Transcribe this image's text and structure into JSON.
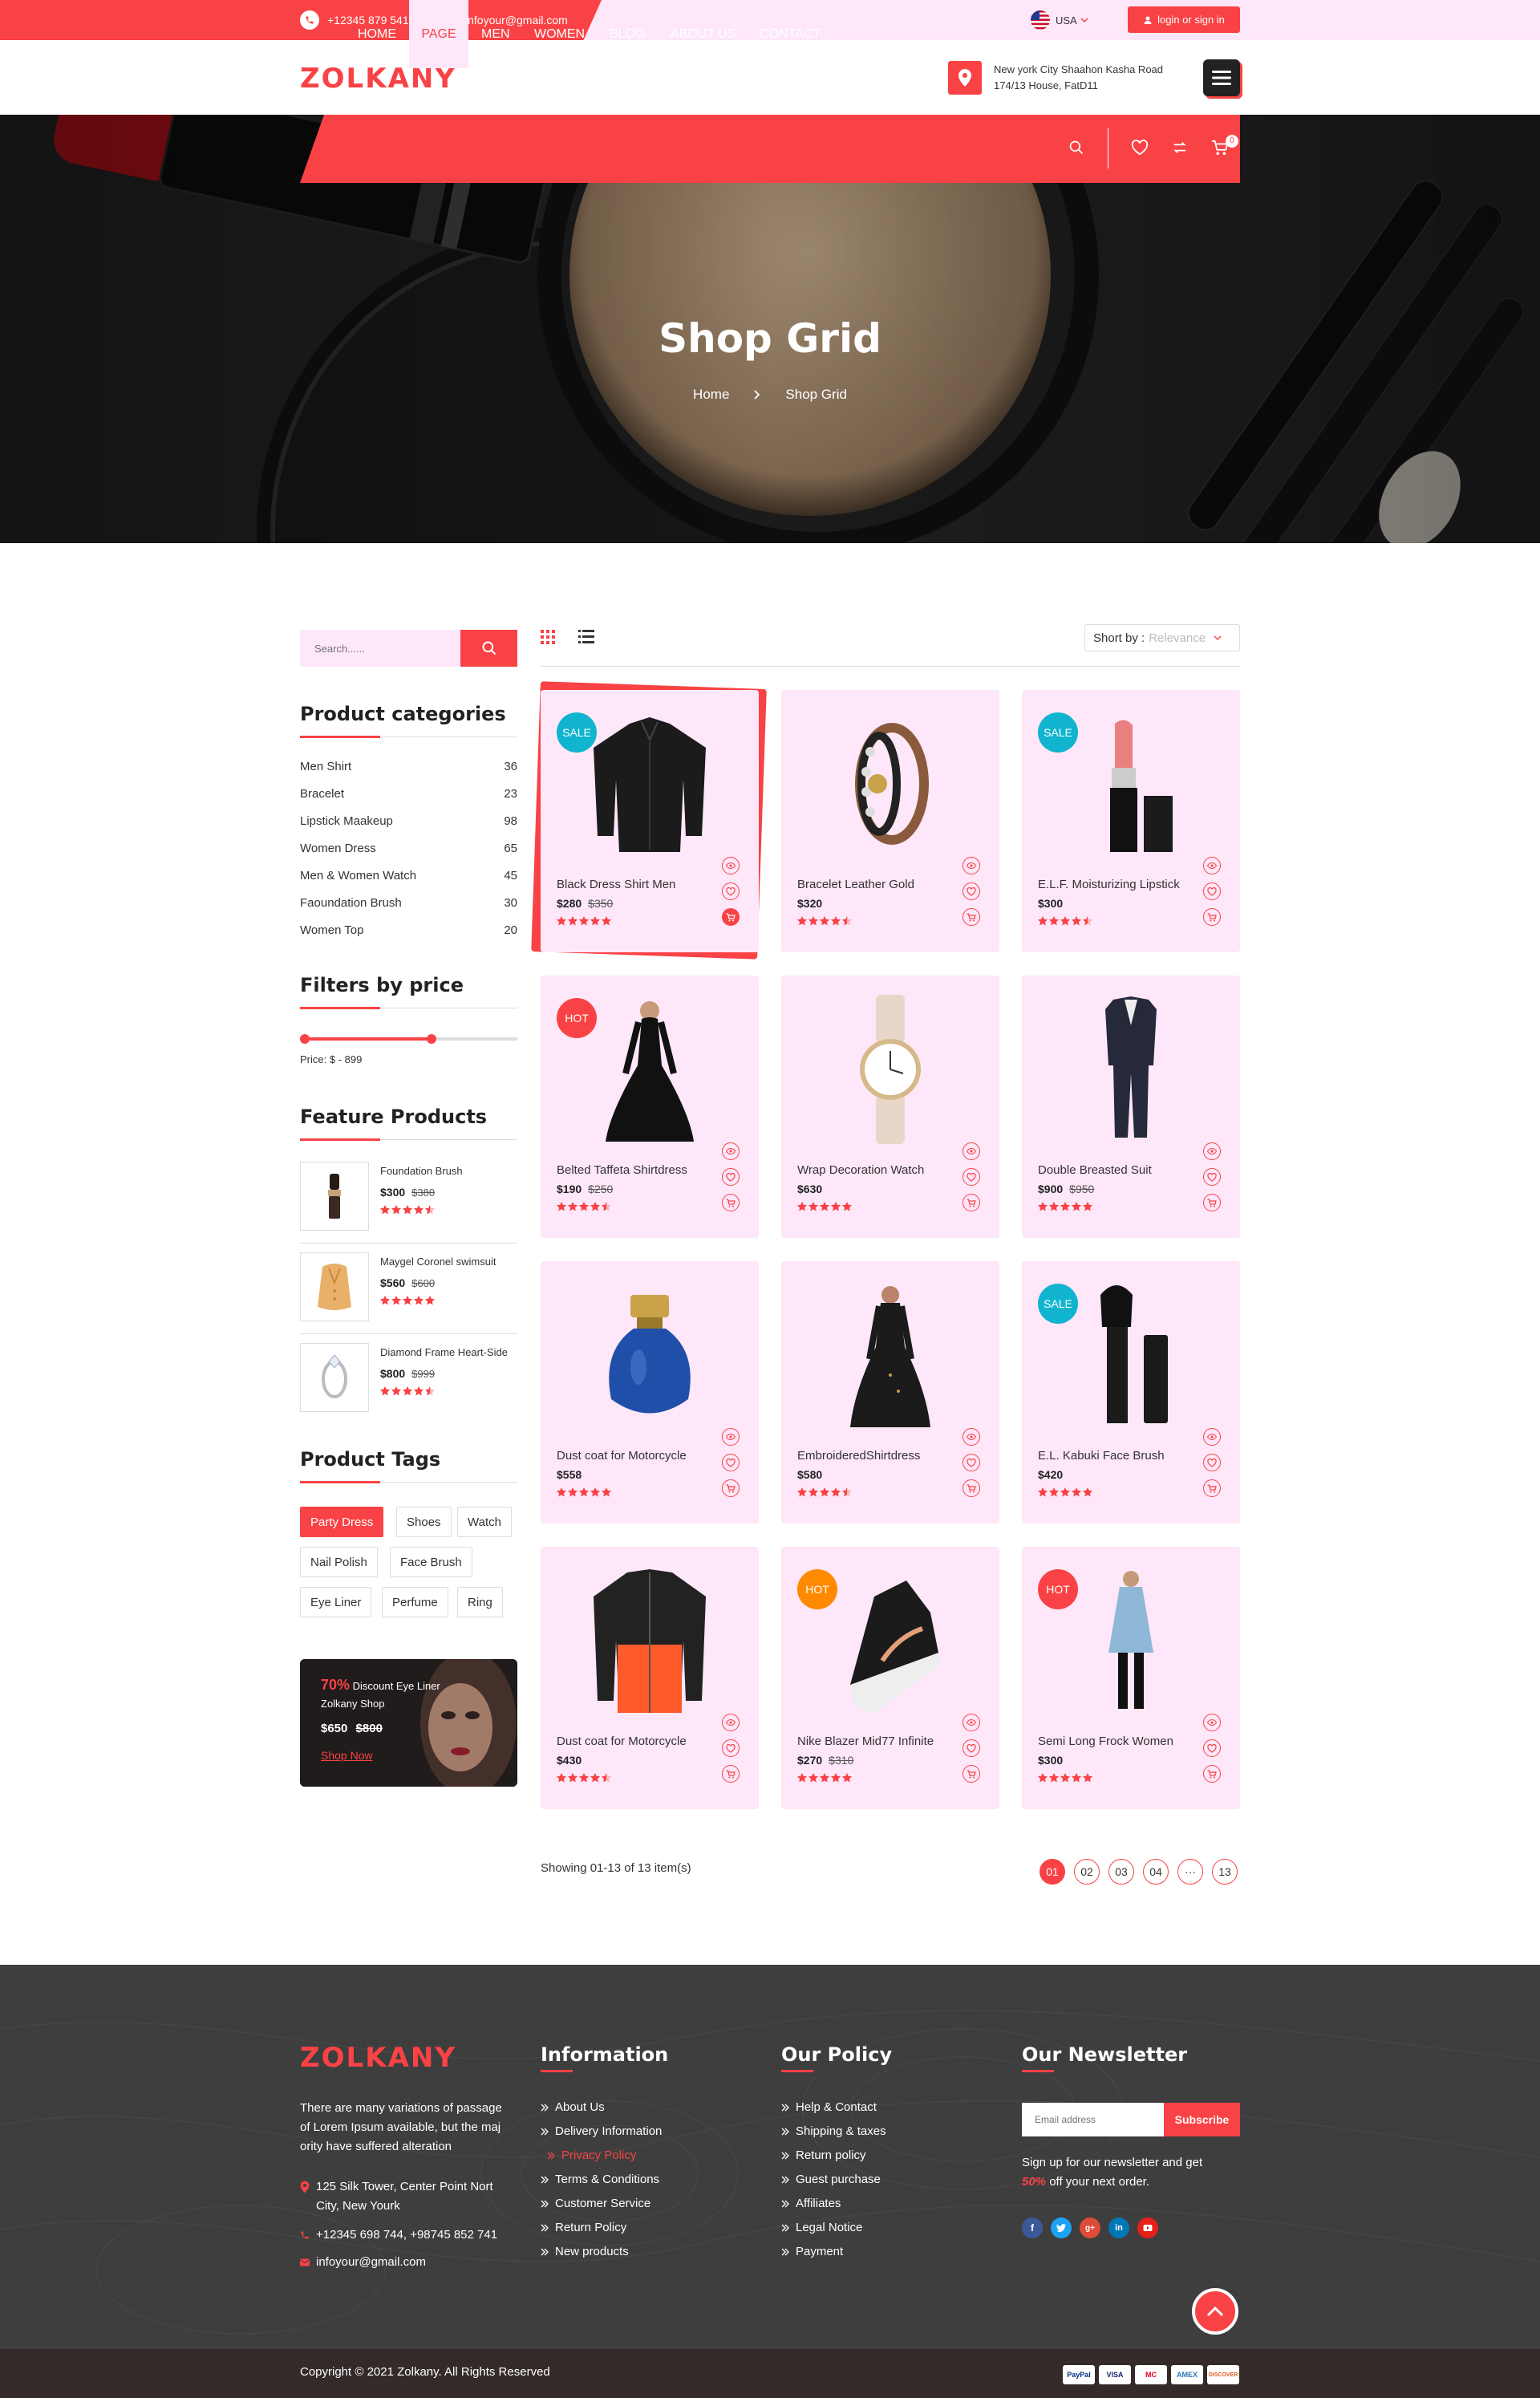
{
  "topbar": {
    "phone": "+12345 879 541",
    "email": "infoyour@gmail.com",
    "language": "USA",
    "login_label": "login or sign in"
  },
  "header": {
    "logo": "ZOLKANY",
    "address_line1": "New york City Shaahon Kasha Road",
    "address_line2": "174/13 House, FatD11"
  },
  "nav": {
    "items": [
      "HOME",
      "PAGE",
      "MEN",
      "WOMEN",
      "BLOG",
      "ABOUT US",
      "CONTACT"
    ],
    "active": "PAGE",
    "cart_count": "0"
  },
  "hero": {
    "title": "Shop Grid",
    "breadcrumb_home": "Home",
    "breadcrumb_current": "Shop Grid"
  },
  "sidebar": {
    "search_placeholder": "Search......",
    "categories_title": "Product categories",
    "categories": [
      {
        "name": "Men Shirt",
        "count": "36"
      },
      {
        "name": "Bracelet",
        "count": "23"
      },
      {
        "name": "Lipstick Maakeup",
        "count": "98"
      },
      {
        "name": "Women Dress",
        "count": "65"
      },
      {
        "name": "Men & Women Watch",
        "count": "45"
      },
      {
        "name": "Faoundation Brush",
        "count": "30"
      },
      {
        "name": "Women Top",
        "count": "20"
      }
    ],
    "price_title": "Filters by price",
    "price_label": "Price: $ - 899",
    "price_range_fraction": [
      0,
      0.6
    ],
    "featured_title": "Feature Products",
    "featured": [
      {
        "name": "Foundation Brush",
        "price": "$300",
        "old": "$380",
        "rating": 4.5
      },
      {
        "name": "Maygel Coronel swimsuit",
        "price": "$560",
        "old": "$600",
        "rating": 5
      },
      {
        "name": "Diamond Frame Heart-Side",
        "price": "$800",
        "old": "$999",
        "rating": 4.5
      }
    ],
    "tags_title": "Product Tags",
    "tags": [
      "Party Dress",
      "Shoes",
      "Watch",
      "Nail Polish",
      "Face Brush",
      "Eye Liner",
      "Perfume",
      "Ring"
    ],
    "active_tag": "Party Dress",
    "promo": {
      "percent": "70%",
      "line1": "Discount Eye Liner",
      "line2": "Zolkany Shop",
      "price": "$650",
      "old": "$800",
      "cta": "Shop Now"
    }
  },
  "toolbar": {
    "sort_label": "Short by :",
    "sort_value": "Relevance"
  },
  "products": [
    {
      "name": "Black Dress Shirt Men",
      "price": "$280",
      "old": "$350",
      "badge": "SALE",
      "rating": 5
    },
    {
      "name": "Bracelet Leather Gold",
      "price": "$320",
      "old": "",
      "badge": "",
      "rating": 4.5
    },
    {
      "name": "E.L.F. Moisturizing Lipstick",
      "price": "$300",
      "old": "",
      "badge": "SALE",
      "rating": 4.5
    },
    {
      "name": "Belted Taffeta Shirtdress",
      "price": "$190",
      "old": "$250",
      "badge": "HOT",
      "rating": 4.5
    },
    {
      "name": "Wrap Decoration Watch",
      "price": "$630",
      "old": "",
      "badge": "",
      "rating": 5
    },
    {
      "name": "Double Breasted Suit",
      "price": "$900",
      "old": "$950",
      "badge": "",
      "rating": 5
    },
    {
      "name": "Dust coat for Motorcycle",
      "price": "$558",
      "old": "",
      "badge": "",
      "rating": 5
    },
    {
      "name": "EmbroideredShirtdress",
      "price": "$580",
      "old": "",
      "badge": "",
      "rating": 4.5
    },
    {
      "name": "E.L. Kabuki Face Brush",
      "price": "$420",
      "old": "",
      "badge": "SALE",
      "rating": 5
    },
    {
      "name": "Dust coat for Motorcycle",
      "price": "$430",
      "old": "",
      "badge": "",
      "rating": 4.5
    },
    {
      "name": "Nike Blazer Mid77 Infinite",
      "price": "$270",
      "old": "$310",
      "badge": "HOT",
      "rating": 5
    },
    {
      "name": "Semi Long Frock Women",
      "price": "$300",
      "old": "",
      "badge": "HOT",
      "rating": 5
    }
  ],
  "pagination": {
    "showing": "Showing 01-13 of 13 item(s)",
    "pages": [
      "01",
      "02",
      "03",
      "04",
      "···",
      "13"
    ],
    "active": "01"
  },
  "footer": {
    "logo": "ZOLKANY",
    "about": [
      "There are many variations of passage",
      "of Lorem Ipsum available, but the maj",
      "ority have suffered alteration"
    ],
    "address": [
      "125 Silk Tower, Center Point Nort",
      "City, New Yourk"
    ],
    "phone": "+12345 698 744, +98745 852 741",
    "email": "infoyour@gmail.com",
    "info_title": "Information",
    "info_links": [
      "About Us",
      "Delivery Information",
      "Privacy Policy",
      "Terms & Conditions",
      "Customer Service",
      "Return Policy",
      "New products"
    ],
    "info_active": "Privacy Policy",
    "policy_title": "Our Policy",
    "policy_links": [
      "Help & Contact",
      "Shipping & taxes",
      "Return policy",
      "Guest purchase",
      "Affiliates",
      "Legal Notice",
      "Payment"
    ],
    "newsletter_title": "Our Newsletter",
    "email_placeholder": "Email address",
    "subscribe_label": "Subscribe",
    "newsletter_text1": "Sign up for our newsletter and get",
    "newsletter_pct": "50%",
    "newsletter_text2": "off your next order.",
    "copyright": "Copyright © 2021 Zolkany. All Rights Reserved",
    "payments": [
      "PayPal",
      "VISA",
      "MC",
      "AMEX",
      "DISCOVER"
    ]
  },
  "colors": {
    "accent": "#f94245",
    "pink_bg": "#fde7f8",
    "sale_badge": "#10b4cf",
    "hot_badge_red": "#f94245",
    "hot_badge_orange": "#ff8a00",
    "footer_bg": "#3e3e3e"
  }
}
